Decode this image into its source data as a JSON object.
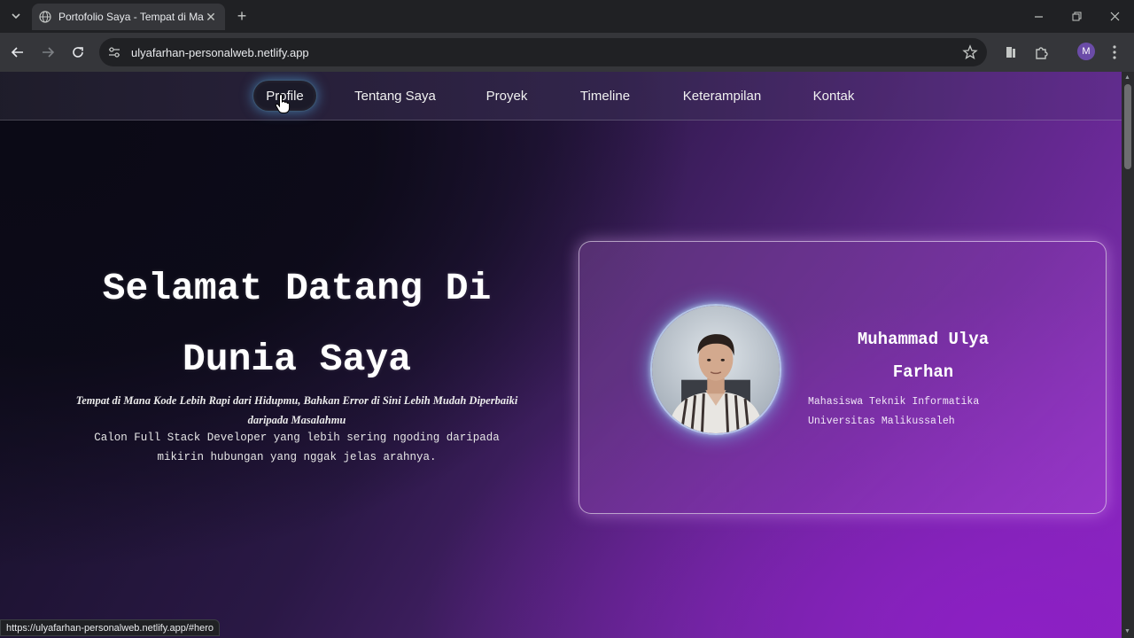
{
  "browser": {
    "tab_title": "Portofolio Saya - Tempat di Ma",
    "url": "ulyafarhan-personalweb.netlify.app",
    "profile_initial": "M",
    "status_url": "https://ulyafarhan-personalweb.netlify.app/#hero"
  },
  "nav": {
    "items": [
      {
        "label": "Profile",
        "active": true
      },
      {
        "label": "Tentang Saya"
      },
      {
        "label": "Proyek"
      },
      {
        "label": "Timeline"
      },
      {
        "label": "Keterampilan"
      },
      {
        "label": "Kontak"
      }
    ]
  },
  "hero": {
    "title_line1": "Selamat Datang Di",
    "title_line2": "Dunia Saya",
    "tagline_line1": "Tempat di Mana Kode Lebih Rapi dari Hidupmu, Bahkan Error di Sini Lebih Mudah Diperbaiki",
    "tagline_line2": "daripada Masalahmu",
    "desc_line1": "Calon Full Stack Developer yang lebih sering ngoding daripada",
    "desc_line2": "mikirin hubungan yang nggak jelas arahnya."
  },
  "profile_card": {
    "name_line1": "Muhammad Ulya",
    "name_line2": "Farhan",
    "role_line1": "Mahasiswa Teknik Informatika",
    "role_line2": "Universitas Malikussaleh"
  },
  "icons": {
    "tab_search": "chevron-down-icon",
    "favicon": "globe-icon",
    "back": "arrow-left-icon",
    "forward": "arrow-right-icon",
    "reload": "reload-icon",
    "site_info": "tune-icon",
    "bookmark": "star-icon",
    "extensions": "puzzle-icon"
  },
  "colors": {
    "accent_glow": "#5abeff",
    "gradient_purple": "#8c1fc4",
    "gradient_dark": "#0b0a16"
  }
}
